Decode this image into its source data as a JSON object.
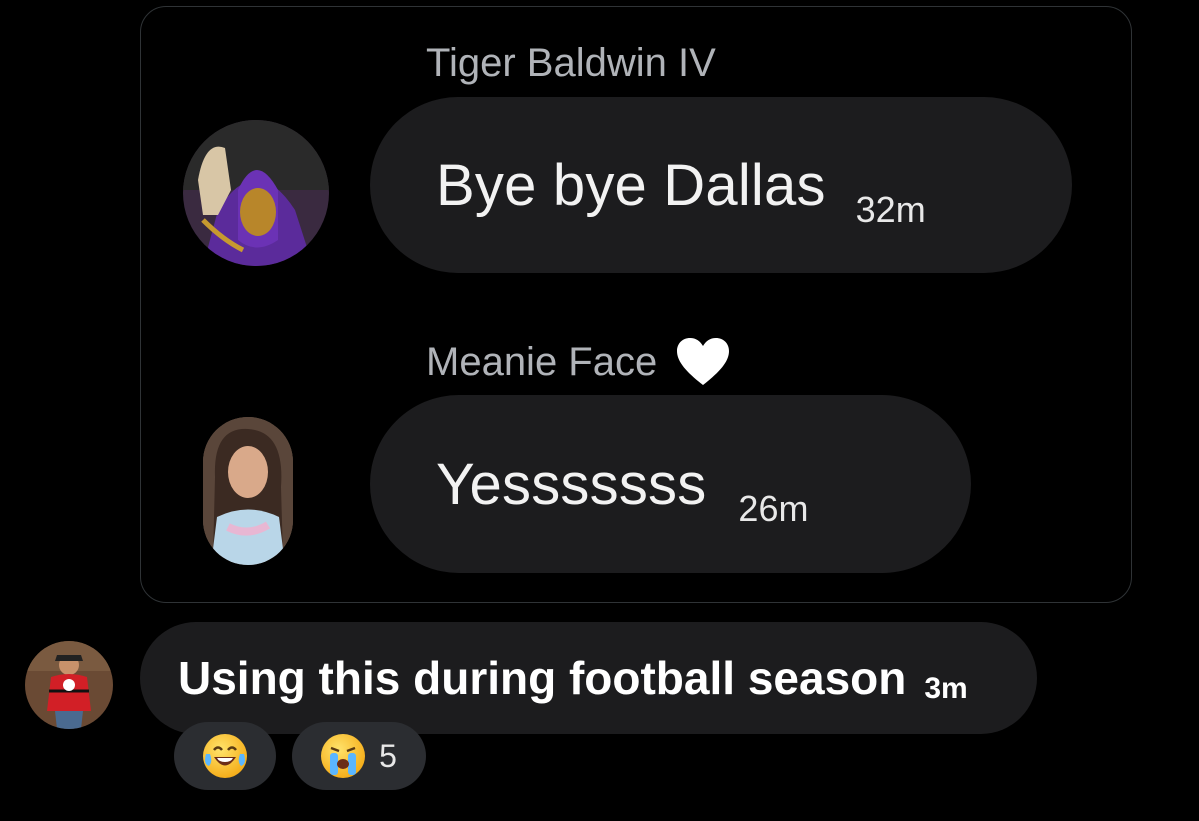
{
  "quoted_messages": [
    {
      "sender": "Tiger Baldwin IV",
      "text": "Bye bye Dallas",
      "time": "32m"
    },
    {
      "sender": "Meanie Face",
      "sender_badge_icon": "white-heart-icon",
      "text": "Yesssssss",
      "time": "26m"
    }
  ],
  "reply": {
    "text": "Using this during football season",
    "time": "3m",
    "reactions": [
      {
        "icon": "laughing-tears-emoji-icon",
        "count": ""
      },
      {
        "icon": "crying-face-emoji-icon",
        "count": "5"
      }
    ]
  },
  "colors": {
    "background": "#000000",
    "bubble": "#1c1c1e",
    "reaction_pill": "#2b2d31",
    "sender_name": "#b0b3b8",
    "card_border": "#2f3336"
  }
}
